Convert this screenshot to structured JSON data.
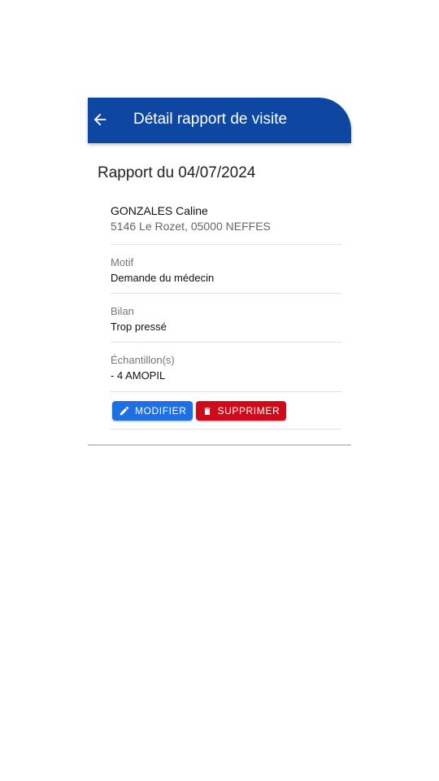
{
  "appbar": {
    "title": "Détail rapport de visite",
    "back_icon": "arrow-left-icon",
    "color": "#0d47a1"
  },
  "report": {
    "heading": "Rapport du 04/07/2024",
    "doctor_name": "GONZALES Caline",
    "doctor_address": "5146 Le Rozet, 05000 NEFFES",
    "motif_label": "Motif",
    "motif_value": "Demande du médecin",
    "bilan_label": "Bilan",
    "bilan_value": "Trop pressé",
    "samples_label": "Échantillon(s)",
    "samples_value": "- 4 AMOPIL"
  },
  "actions": {
    "edit_label": "MODIFIER",
    "edit_icon": "pencil-icon",
    "edit_color": "#1e6fe3",
    "delete_label": "SUPPRIMER",
    "delete_icon": "trash-icon",
    "delete_color": "#cf0a1a"
  }
}
